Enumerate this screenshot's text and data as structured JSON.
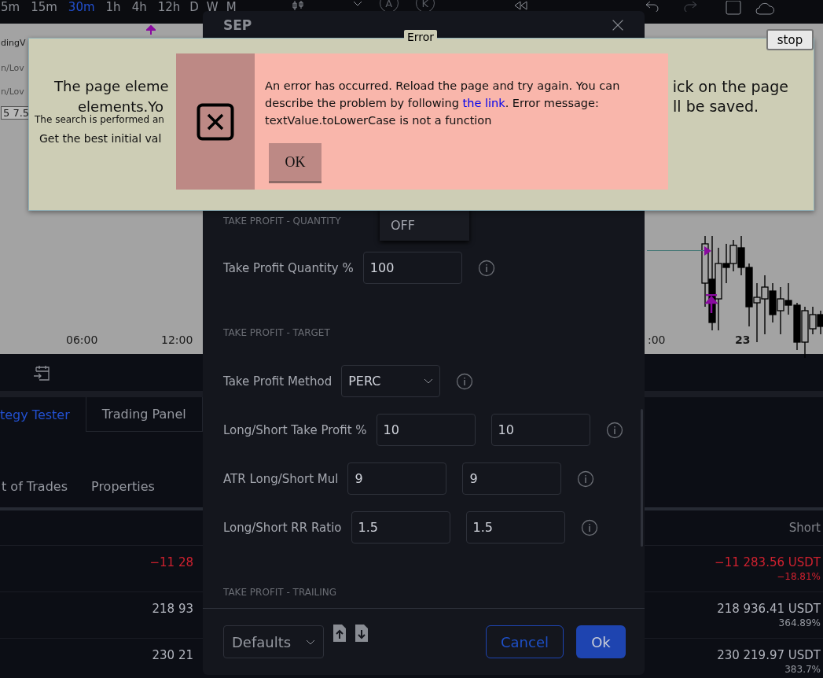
{
  "toolbar": {
    "intervals": [
      {
        "label": "5m",
        "selected": false
      },
      {
        "label": "15m",
        "selected": false
      },
      {
        "label": "30m",
        "selected": true
      },
      {
        "label": "1h",
        "selected": false
      },
      {
        "label": "4h",
        "selected": false
      },
      {
        "label": "12h",
        "selected": false
      },
      {
        "label": "D",
        "selected": false
      },
      {
        "label": "W",
        "selected": false
      },
      {
        "label": "M",
        "selected": false
      }
    ],
    "circled_letters": [
      "A",
      "K"
    ]
  },
  "chart": {
    "legend": [
      "dingV",
      "n/Lov",
      "n/Lov",
      "5 7.5"
    ],
    "time_axis": [
      "06:00",
      "12:00",
      ":00",
      "23"
    ]
  },
  "bottom_panel": {
    "tabs": [
      {
        "label": "tegy Tester",
        "selected": true
      },
      {
        "label": "Trading Panel",
        "selected": false
      }
    ],
    "subtabs": [
      "t of Trades",
      "Properties"
    ],
    "table": {
      "column_header": "Short",
      "rows": [
        {
          "left": "−11 28",
          "right": "−11 283.56 USDT",
          "right_sub": "−18.81%",
          "negative": true
        },
        {
          "left": "218 93",
          "right": "218 936.41 USDT",
          "right_sub": "364.89%",
          "negative": false
        },
        {
          "left": "230 21",
          "right": "230 219.97 USDT",
          "right_sub": "383.7%",
          "negative": false
        }
      ]
    }
  },
  "settings_dialog": {
    "title": "SEP",
    "dropdown_option": "OFF",
    "sections": [
      {
        "title": "TAKE PROFIT - QUANTITY",
        "rows": [
          {
            "label": "Take Profit Quantity %",
            "kind": "input",
            "values": [
              "100"
            ]
          }
        ]
      },
      {
        "title": "TAKE PROFIT - TARGET",
        "rows": [
          {
            "label": "Take Profit Method",
            "kind": "select",
            "values": [
              "PERC"
            ]
          },
          {
            "label": "Long/Short Take Profit %",
            "kind": "input",
            "values": [
              "10",
              "10"
            ]
          },
          {
            "label": "ATR Long/Short Mul",
            "kind": "input",
            "values": [
              "9",
              "9"
            ]
          },
          {
            "label": "Long/Short RR Ratio",
            "kind": "input",
            "values": [
              "1.5",
              "1.5"
            ]
          }
        ]
      },
      {
        "title": "TAKE PROFIT - TRAILING"
      }
    ],
    "footer": {
      "preset": "Defaults",
      "buttons": [
        {
          "label": "Cancel",
          "kind": "secondary"
        },
        {
          "label": "Ok",
          "kind": "primary"
        }
      ]
    }
  },
  "notice": {
    "title": "Error",
    "left_lines": [
      "The page eleme",
      "elements.Yo",
      "The search is performed an",
      "Get the best initial val"
    ],
    "right_lines": [
      "ick on the page",
      "ll be saved."
    ]
  },
  "error_box": {
    "message_before": "An error has occurred. Reload the page and try again. You can describe the problem by following ",
    "link": "the link",
    "message_after": ". Error message: textValue.toLowerCase is not a function",
    "button": "OK"
  },
  "stop_button": "stop"
}
